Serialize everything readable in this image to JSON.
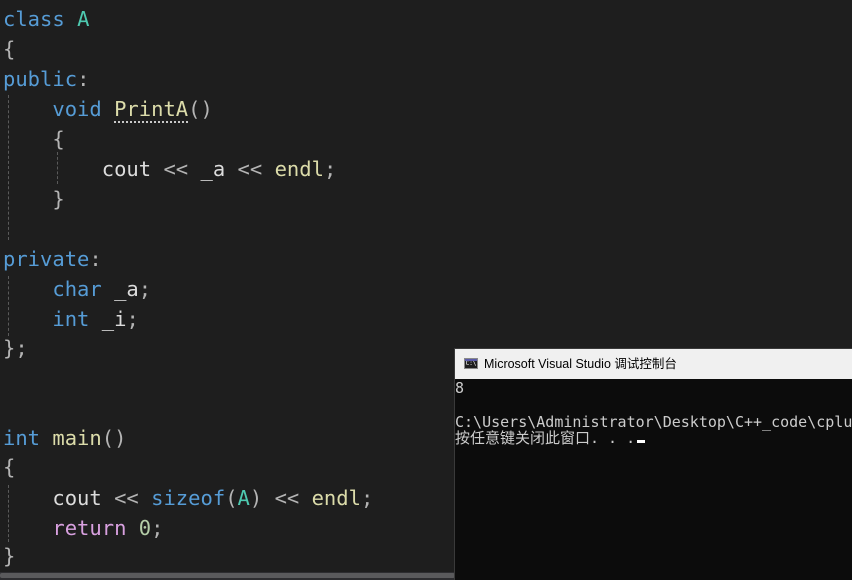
{
  "editor": {
    "line_class": {
      "keyword": "class",
      "name": "A"
    },
    "line_brace_open_1": "{",
    "line_public": {
      "keyword": "public",
      "colon": ":"
    },
    "line_printa": {
      "type": "void",
      "name": "PrintA",
      "parens": "()"
    },
    "line_brace_open_2": "{",
    "line_cout_a": {
      "fn": "cout",
      "op1": "<<",
      "var": "_a",
      "op2": "<<",
      "endl": "endl",
      "semi": ";"
    },
    "line_brace_close_2": "}",
    "line_private": {
      "keyword": "private",
      "colon": ":"
    },
    "line_char": {
      "type": "char",
      "name": "_a",
      "semi": ";"
    },
    "line_int_i": {
      "type": "int",
      "name": "_i",
      "semi": ";"
    },
    "line_class_end": "};",
    "line_main": {
      "type": "int",
      "name": "main",
      "parens": "()"
    },
    "line_brace_open_3": "{",
    "line_cout_sizeof": {
      "fn": "cout",
      "op1": "<<",
      "sizeof": "sizeof",
      "open": "(",
      "arg": "A",
      "close": ")",
      "op2": "<<",
      "endl": "endl",
      "semi": ";"
    },
    "line_return": {
      "keyword": "return",
      "value": "0",
      "semi": ";"
    },
    "line_brace_close_3": "}"
  },
  "console": {
    "title": "Microsoft Visual Studio 调试控制台",
    "icon_name": "console-app-icon",
    "icon_text": "C:\\",
    "output_value": "8",
    "path_line": "C:\\Users\\Administrator\\Desktop\\C++_code\\cplus",
    "prompt": "按任意键关闭此窗口. . ."
  },
  "colors": {
    "background": "#1e1e1e",
    "keyword": "#569cd6",
    "control_keyword": "#d8a0df",
    "type_name": "#4ec9b0",
    "function": "#dcdcaa",
    "number": "#b5cea8",
    "console_background": "#0c0c0c",
    "console_titlebar": "#f0f0f0"
  }
}
